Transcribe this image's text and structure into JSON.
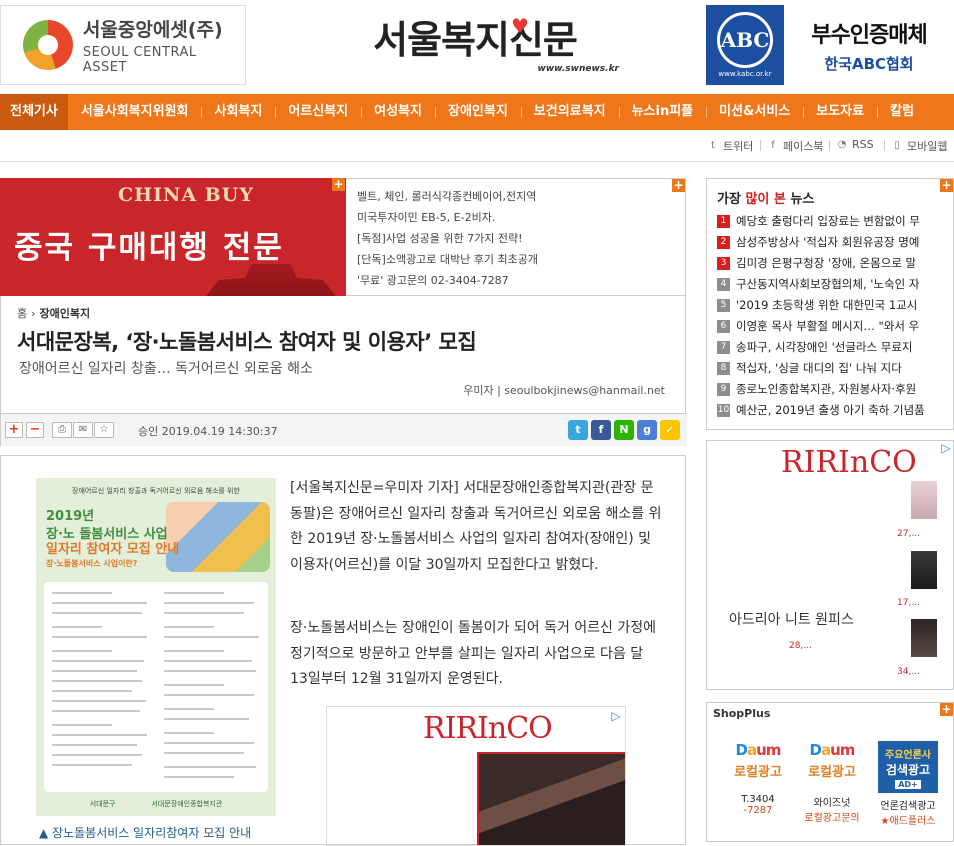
{
  "header": {
    "left_ad": {
      "korean": "서울중앙에셋(주)",
      "english": "SEOUL CENTRAL ASSET"
    },
    "logo": {
      "title": "서울복지신문",
      "url": "www.swnews.kr"
    },
    "right_ad": {
      "abc": "ABC",
      "abc_url": "www.kabc.or.kr",
      "line1": "부수인증매체",
      "line2": "한국ABC협회"
    }
  },
  "nav": {
    "items": [
      "전체기사",
      "서울사회복지위원회",
      "사회복지",
      "어르신복지",
      "여성복지",
      "장애인복지",
      "보건의료복지",
      "뉴스in피플",
      "미션&서비스",
      "보도자료",
      "칼럼"
    ]
  },
  "social": {
    "twitter": "트위터",
    "facebook": "페이스북",
    "rss": "RSS",
    "mobile": "모바일웹"
  },
  "banner": {
    "line1": "CHINA BUY",
    "line2": "중국 구매대행 전문"
  },
  "text_ads": [
    "벨트, 체인, 롤러식각종컨베이어,전지역",
    "미국투자이민 EB-5, E-2비자.",
    "[독점]사업 성공을 위한 7가지 전략!",
    "[단독]소액광고로 대박난 후기 최초공개",
    "'무료' 광고문의 02-3404-7287"
  ],
  "article": {
    "breadcrumb_home": "홈",
    "breadcrumb_category": "장애인복지",
    "title": "서대문장복, ‘장·노돌봄서비스 참여자 및 이용자’ 모집",
    "subtitle": "장애어르신 일자리 창출… 독거어르신 외로움 해소",
    "byline": "우미자 | seoulbokjinews@hanmail.net",
    "approval": "승인 2019.04.19  14:30:37",
    "paragraph1": "[서울복지신문=우미자 기자] 서대문장애인종합복지관(관장 문동팔)은 장애어르신 일자리 창출과 독거어르신 외로움 해소를 위한 2019년 장·노돌봄서비스 사업의 일자리 참여자(장애인) 및 이용자(어르신)를 이달 30일까지 모집한다고 밝혔다.",
    "paragraph2": "장·노돌봄서비스는 장애인이 돌봄이가 되어 독거 어르신 가정에 정기적으로 방문하고 안부를 살피는 일자리 사업으로 다음 달 13일부터 12월 31일까지 운영된다.",
    "caption": "▲ 장노돌봄서비스 일자리참여자 모집 안내",
    "poster": {
      "header": "장애어르신 일자리 창출과 독거어르신 외로움 해소를 위한",
      "year": "2019년",
      "line1": "장·노 돌봄서비스 사업",
      "line2": "일자리 참여자 모집 안내",
      "q": "장·노돌봄서비스 사업이란?",
      "foot1": "서대문구",
      "foot2": "서대문장애인종합복지관"
    }
  },
  "popular": {
    "title_pre": "가장 ",
    "title_red": "많이 본",
    "title_post": " 뉴스",
    "items": [
      "예당호 출렁다리 입장료는 변함없이 무",
      "삼성주방상사 '적십자 회원유공장 명예",
      "김미경 은평구청장 '장애, 온몸으로 말",
      "구산동지역사회보장협의체, '노숙인 자",
      "'2019 초등학생 위한 대한민국 1교시",
      "이영훈 목사 부활절 메시지… \"와서 우",
      "송파구, 시각장애인 '선글라스 무료지",
      "적십자, '싱글 대디의 집' 나눠 지다",
      "종로노인종합복지관, 자원봉사자·후원",
      "예산군, 2019년 출생 아기 축하 기념품"
    ],
    "colors": {
      "top": "#d81e1e",
      "rest": "#8e8e8e"
    }
  },
  "side_ad": {
    "brand": "RIRInCO",
    "product": "아드리아 니트 원피스",
    "price": "28,...",
    "thumb_prices": [
      "27,...",
      "17,...",
      "34,..."
    ]
  },
  "shopplus": {
    "title": "ShopPlus",
    "items": [
      {
        "line1": "Daum",
        "line2": "로컬광고",
        "name": "T.3404",
        "sub": "-7287"
      },
      {
        "line1": "Daum",
        "line2": "로컬광고",
        "name": "와이즈넛",
        "sub": "로컬광고문의"
      },
      {
        "line1": "주요언론사",
        "line2": "검색광고",
        "name": "언론검색광고",
        "sub": "★애드플러스"
      }
    ]
  },
  "colors": {
    "accent": "#f0761a",
    "nav_active": "#c95a0e",
    "link": "#235d8c"
  }
}
